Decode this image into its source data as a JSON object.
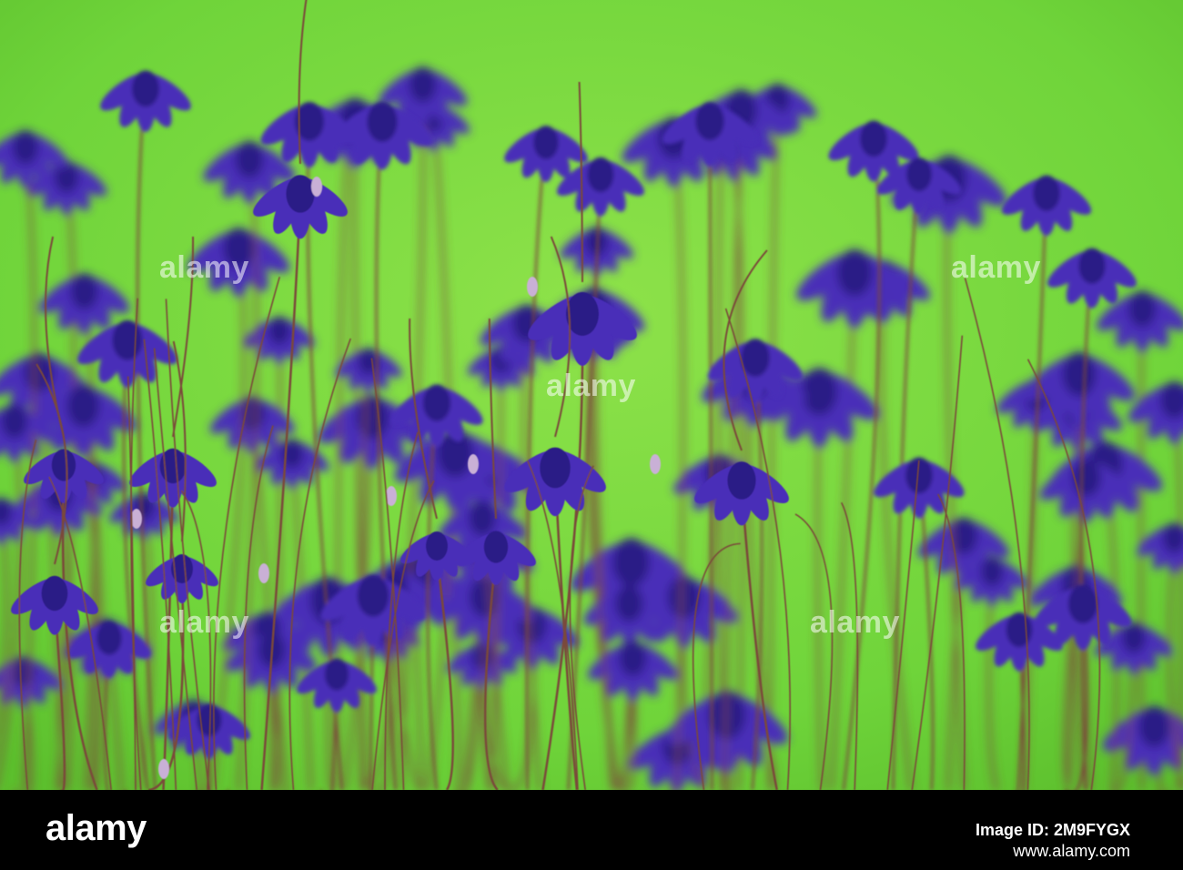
{
  "photo": {
    "subject": "purple columbine flowers",
    "colors": {
      "background": "#6fd43a",
      "background_light": "#8ee24a",
      "flower": "#4a2fb8",
      "flower_dark": "#2c1a86",
      "stem": "#7a4a3a",
      "bud": "#c9b0d6"
    }
  },
  "watermark": {
    "text": "alamy"
  },
  "footer": {
    "brand": "alamy",
    "image_id_label": "Image ID: 2M9FYGX",
    "site": "www.alamy.com"
  }
}
